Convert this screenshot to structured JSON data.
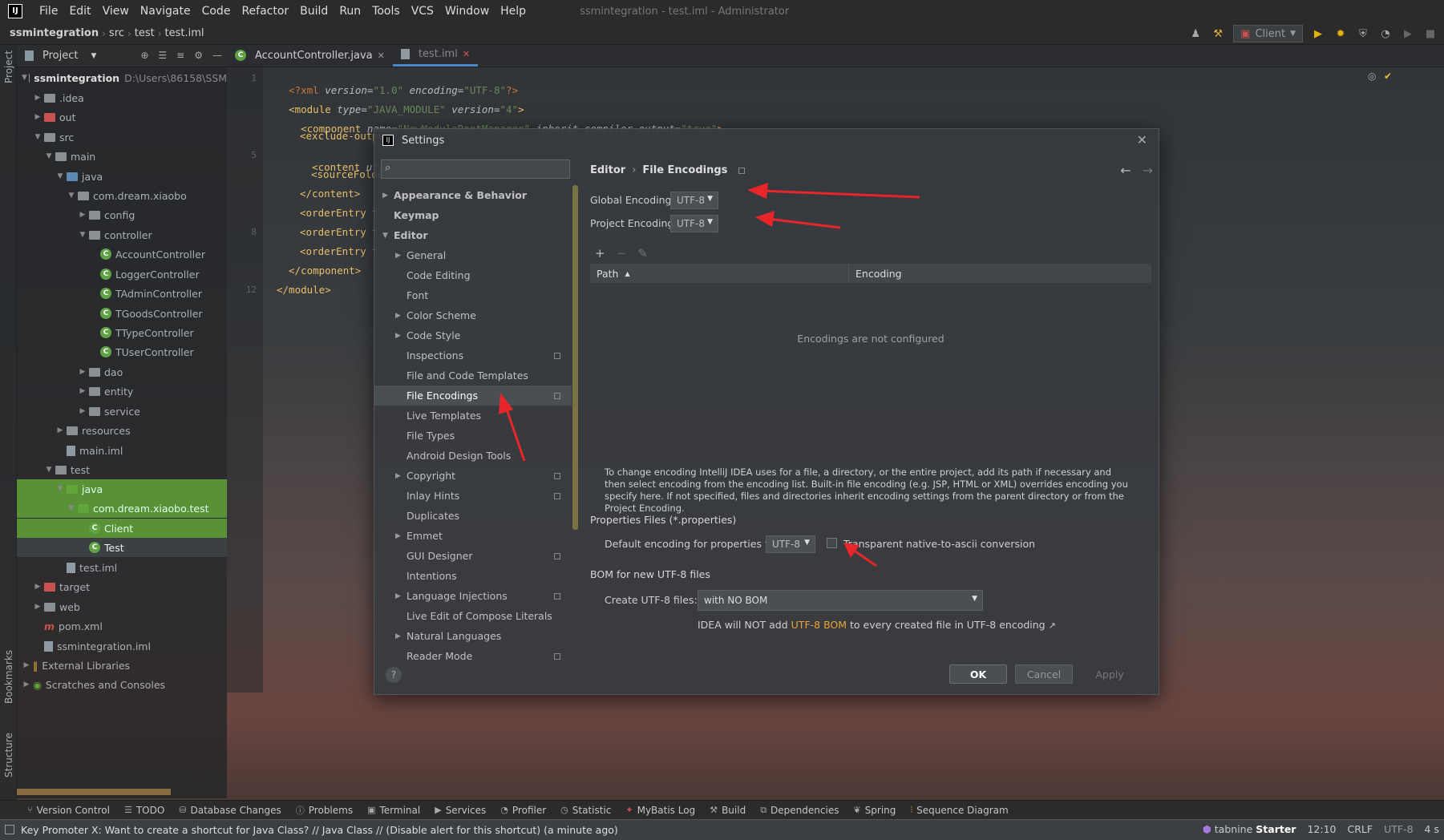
{
  "app": {
    "window_title": "ssmintegration - test.iml - Administrator",
    "logo_letter": "IJ",
    "menu": [
      "File",
      "Edit",
      "View",
      "Navigate",
      "Code",
      "Refactor",
      "Build",
      "Run",
      "Tools",
      "VCS",
      "Window",
      "Help"
    ]
  },
  "breadcrumb": [
    "ssmintegration",
    "src",
    "test",
    "test.iml"
  ],
  "run_config": {
    "label": "Client"
  },
  "side_strip": {
    "project": "Project",
    "bookmarks": "Bookmarks",
    "structure": "Structure"
  },
  "project_panel": {
    "title": "Project",
    "root_name": "ssmintegration",
    "root_path": "D:\\Users\\86158\\SSM",
    "items": [
      {
        "label": ".idea"
      },
      {
        "label": "out"
      },
      {
        "label": "src"
      },
      {
        "label": "main"
      },
      {
        "label": "java"
      },
      {
        "label": "com.dream.xiaobo"
      },
      {
        "label": "config"
      },
      {
        "label": "controller"
      },
      {
        "label": "AccountController"
      },
      {
        "label": "LoggerController"
      },
      {
        "label": "TAdminController"
      },
      {
        "label": "TGoodsController"
      },
      {
        "label": "TTypeController"
      },
      {
        "label": "TUserController"
      },
      {
        "label": "dao"
      },
      {
        "label": "entity"
      },
      {
        "label": "service"
      },
      {
        "label": "resources"
      },
      {
        "label": "main.iml"
      },
      {
        "label": "test"
      },
      {
        "label": "java"
      },
      {
        "label": "com.dream.xiaobo.test"
      },
      {
        "label": "Client"
      },
      {
        "label": "Test"
      },
      {
        "label": "test.iml"
      },
      {
        "label": "target"
      },
      {
        "label": "web"
      },
      {
        "label": "pom.xml"
      },
      {
        "label": "ssmintegration.iml"
      },
      {
        "label": "External Libraries"
      },
      {
        "label": "Scratches and Consoles"
      }
    ]
  },
  "editor": {
    "tabs": [
      {
        "label": "AccountController.java"
      },
      {
        "label": "test.iml"
      }
    ],
    "line_numbers": {
      "l1": "1",
      "l5": "5",
      "l8": "8",
      "l12": "12"
    },
    "code": {
      "l1_a": "<?xml ",
      "l1_b": "version=",
      "l1_c": "\"1.0\" ",
      "l1_d": "encoding=",
      "l1_e": "\"UTF-8\"",
      "l1_f": "?>",
      "l2_a": "<module ",
      "l2_b": "type=",
      "l2_c": "\"JAVA_MODULE\" ",
      "l2_d": "version=",
      "l2_e": "\"4\"",
      "l2_f": ">",
      "l3_a": "<component ",
      "l3_b": "name=",
      "l3_c": "\"NewModuleRootManager\" ",
      "l3_d": "inherit-compiler-output=",
      "l3_e": "\"true\"",
      "l3_f": ">",
      "l4": "<exclude-outpu",
      "l5_a": "<content ",
      "l5_b": "url=",
      "l5_c": "\"",
      "l6": "<sourceFolde",
      "l7": "</content>",
      "l8": "<orderEntry t",
      "l9": "<orderEntry t",
      "l10": "<orderEntry t",
      "l11": "</component>",
      "l12": "</module>"
    }
  },
  "settings": {
    "title": "Settings",
    "search_placeholder": "",
    "nav": [
      {
        "label": "Appearance & Behavior"
      },
      {
        "label": "Keymap"
      },
      {
        "label": "Editor"
      },
      {
        "label": "General"
      },
      {
        "label": "Code Editing"
      },
      {
        "label": "Font"
      },
      {
        "label": "Color Scheme"
      },
      {
        "label": "Code Style"
      },
      {
        "label": "Inspections"
      },
      {
        "label": "File and Code Templates"
      },
      {
        "label": "File Encodings"
      },
      {
        "label": "Live Templates"
      },
      {
        "label": "File Types"
      },
      {
        "label": "Android Design Tools"
      },
      {
        "label": "Copyright"
      },
      {
        "label": "Inlay Hints"
      },
      {
        "label": "Duplicates"
      },
      {
        "label": "Emmet"
      },
      {
        "label": "GUI Designer"
      },
      {
        "label": "Intentions"
      },
      {
        "label": "Language Injections"
      },
      {
        "label": "Live Edit of Compose Literals"
      },
      {
        "label": "Natural Languages"
      },
      {
        "label": "Reader Mode"
      }
    ],
    "crumb_parent": "Editor",
    "crumb_current": "File Encodings",
    "global_encoding_label": "Global Encoding:",
    "global_encoding_value": "UTF-8",
    "project_encoding_label": "Project Encoding:",
    "project_encoding_value": "UTF-8",
    "table": {
      "col_path": "Path",
      "col_encoding": "Encoding",
      "empty": "Encodings are not configured"
    },
    "info": "To change encoding IntelliJ IDEA uses for a file, a directory, or the entire project, add its path if necessary and then select encoding from the encoding list. Built-in file encoding (e.g. JSP, HTML or XML) overrides encoding you specify here. If not specified, files and directories inherit encoding settings from the parent directory or from the Project Encoding.",
    "properties_title": "Properties Files (*.properties)",
    "properties_label": "Default encoding for properties files:",
    "properties_value": "UTF-8",
    "transparent_label": "Transparent native-to-ascii conversion",
    "transparent_checked": false,
    "bom_title": "BOM for new UTF-8 files",
    "create_label": "Create UTF-8 files:",
    "create_value": "with NO BOM",
    "bom_note_prefix": "IDEA will NOT add ",
    "bom_note_link": "UTF-8 BOM",
    "bom_note_suffix": " to every created file in UTF-8 encoding",
    "bom_note_ext": "↗",
    "ok": "OK",
    "cancel": "Cancel",
    "apply": "Apply",
    "help": "?"
  },
  "tool_windows": [
    {
      "label": "Version Control",
      "icon": "branch-icon"
    },
    {
      "label": "TODO",
      "icon": "list-icon"
    },
    {
      "label": "Database Changes",
      "icon": "database-icon"
    },
    {
      "label": "Problems",
      "icon": "problems-icon"
    },
    {
      "label": "Terminal",
      "icon": "terminal-icon"
    },
    {
      "label": "Services",
      "icon": "services-icon"
    },
    {
      "label": "Profiler",
      "icon": "profiler-icon"
    },
    {
      "label": "Statistic",
      "icon": "statistic-icon"
    },
    {
      "label": "MyBatis Log",
      "icon": "mybatis-icon"
    },
    {
      "label": "Build",
      "icon": "hammer-icon"
    },
    {
      "label": "Dependencies",
      "icon": "dependencies-icon"
    },
    {
      "label": "Spring",
      "icon": "spring-icon"
    },
    {
      "label": "Sequence Diagram",
      "icon": "sequence-icon"
    }
  ],
  "status": {
    "message": "Key Promoter X: Want to create a shortcut for Java Class? // Java Class // (Disable alert for this shortcut) (a minute ago)",
    "tabnine_brand": "tabnine",
    "tabnine_plan": "Starter",
    "time": "12:10",
    "line_sep": "CRLF",
    "encoding": "UTF-8",
    "indent": "4 s"
  },
  "colors": {
    "accent": "#4a88c7",
    "annotation_arrow": "#e8262a",
    "link": "#e9a53b"
  }
}
